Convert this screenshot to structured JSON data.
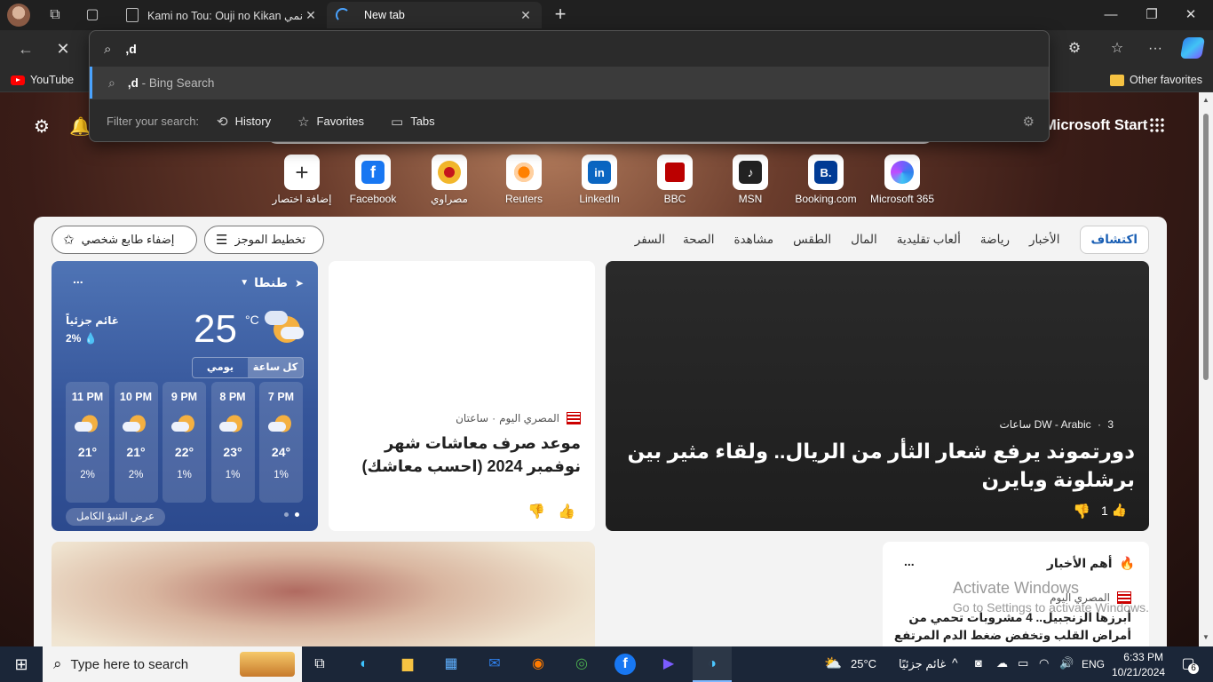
{
  "browser": {
    "tabs": [
      {
        "title": "Kami no Tou: Ouji no Kikan انمي",
        "active": false
      },
      {
        "title": "New tab",
        "active": true
      }
    ]
  },
  "toolbar": {
    "address_value": ",d"
  },
  "omnibox": {
    "query": ",d",
    "suggestion_query": ",d",
    "suggestion_suffix": " - Bing Search",
    "filter_label": "Filter your search:",
    "filters": [
      "History",
      "Favorites",
      "Tabs"
    ]
  },
  "favorites": {
    "youtube": "YouTube",
    "other": "Other favorites"
  },
  "page": {
    "ms_start": "Microsoft Start",
    "quicklinks": [
      "إضافة اختصار",
      "Facebook",
      "مصراوي",
      "Reuters",
      "LinkedIn",
      "BBC",
      "MSN",
      "Booking.com",
      "Microsoft 365"
    ],
    "personalize": "إضفاء طابع شخصي",
    "layout": "تخطيط الموجز",
    "nav_tabs": [
      "اكتشاف",
      "الأخبار",
      "رياضة",
      "ألعاب تقليدية",
      "المال",
      "الطقس",
      "مشاهدة",
      "الصحة",
      "السفر"
    ]
  },
  "weather": {
    "city": "طنطا",
    "more": "...",
    "temp": "25",
    "unit": "°C",
    "condition": "غائم جزئياً",
    "precip": "2%",
    "tab_hourly": "كل ساعة",
    "tab_daily": "يومي",
    "hours": [
      {
        "time": "7 PM",
        "temp": "24°",
        "precip": "1%"
      },
      {
        "time": "8 PM",
        "temp": "23°",
        "precip": "1%"
      },
      {
        "time": "9 PM",
        "temp": "22°",
        "precip": "1%"
      },
      {
        "time": "10 PM",
        "temp": "21°",
        "precip": "2%"
      },
      {
        "time": "11 PM",
        "temp": "21°",
        "precip": "2%"
      }
    ],
    "full_forecast": "عرض التنبؤ الكامل"
  },
  "news_mid": {
    "source": "المصري اليوم",
    "time": "ساعتان",
    "title": "موعد صرف معاشات شهر نوفمبر 2024 (احسب معاشك)"
  },
  "news_big": {
    "source": "DW - Arabic",
    "time": "3 ساعات",
    "title": "دورتموند يرفع شعار الثأر من الريال.. ولقاء مثير بين برشلونة وبايرن",
    "likes": "1"
  },
  "top_news": {
    "heading": "أهم الأخبار",
    "more": "...",
    "source": "المصري اليوم",
    "headline": "أبرزها الزنجبيل.. 4 مشروبات تحمي من أمراض القلب وتخفض ضغط الدم المرتفع"
  },
  "watermark": {
    "title": "Activate Windows",
    "subtitle": "Go to Settings to activate Windows."
  },
  "taskbar": {
    "search_placeholder": "Type here to search",
    "weather_temp": "25°C",
    "weather_text": "غائم جزئيًا",
    "lang": "ENG",
    "time": "6:33 PM",
    "date": "10/21/2024",
    "notif_count": "6"
  }
}
